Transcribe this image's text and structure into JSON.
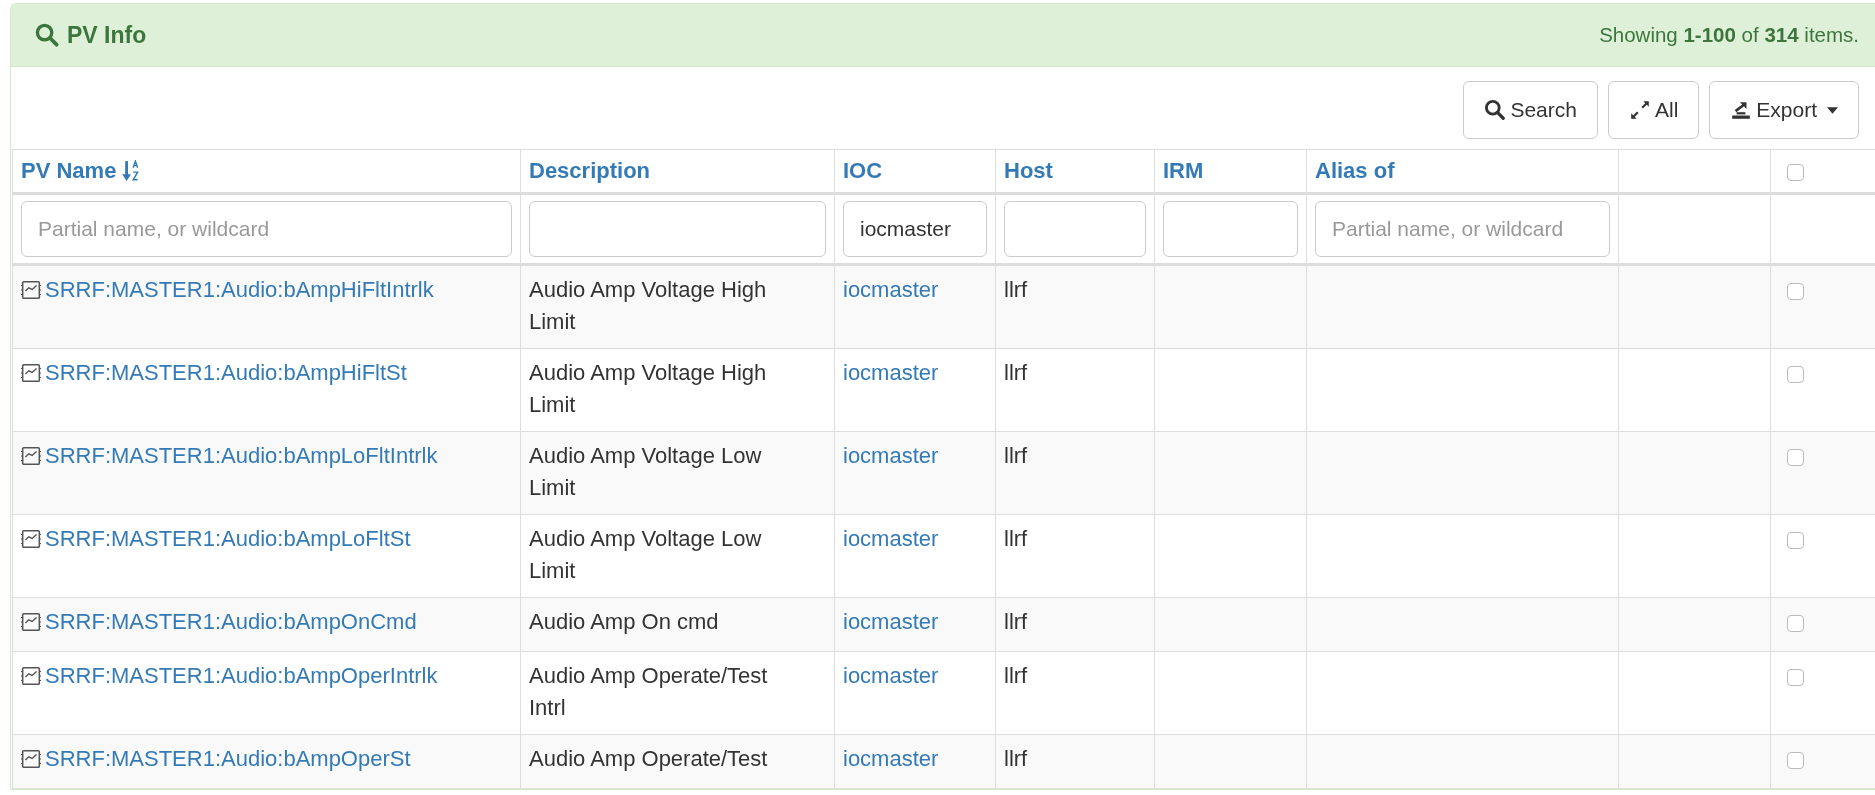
{
  "panel": {
    "title": "PV Info",
    "summary": "Showing **1-100** of **314** items."
  },
  "toolbar": {
    "buttons": [
      {
        "label": "Search",
        "kind": "search"
      },
      {
        "label": "All",
        "kind": "expand"
      },
      {
        "label": "Export",
        "kind": "export"
      }
    ]
  },
  "table": {
    "columns": [
      {
        "label": "PV Name",
        "sorted": true
      },
      {
        "label": "Description",
        "sorted": false
      },
      {
        "label": "IOC",
        "sorted": false
      },
      {
        "label": "Host",
        "sorted": false
      },
      {
        "label": "IRM",
        "sorted": false
      },
      {
        "label": "Alias of",
        "sorted": false
      }
    ],
    "select_all": {
      "checked": false
    },
    "filters": [
      {
        "kind": "input",
        "placeholder": "Partial name, or wildcard"
      },
      {
        "kind": "input"
      },
      {
        "kind": "input",
        "value": "iocmaster"
      },
      {
        "kind": "input"
      },
      {
        "kind": "input"
      },
      {
        "kind": "input",
        "placeholder": "Partial name, or wildcard"
      },
      {
        "kind": "none"
      }
    ],
    "rows": [
      {
        "pv_name": "SRRF:MASTER1:Audio:bAmpHiFltIntrlk",
        "description": "Audio Amp Voltage High Limit",
        "ioc": "iocmaster",
        "host": "llrf",
        "checked": false
      },
      {
        "pv_name": "SRRF:MASTER1:Audio:bAmpHiFltSt",
        "description": "Audio Amp Voltage High Limit",
        "ioc": "iocmaster",
        "host": "llrf",
        "checked": false
      },
      {
        "pv_name": "SRRF:MASTER1:Audio:bAmpLoFltIntrlk",
        "description": "Audio Amp Voltage Low Limit",
        "ioc": "iocmaster",
        "host": "llrf",
        "checked": false
      },
      {
        "pv_name": "SRRF:MASTER1:Audio:bAmpLoFltSt",
        "description": "Audio Amp Voltage Low Limit",
        "ioc": "iocmaster",
        "host": "llrf",
        "checked": false
      },
      {
        "pv_name": "SRRF:MASTER1:Audio:bAmpOnCmd",
        "description": "Audio Amp On cmd",
        "ioc": "iocmaster",
        "host": "llrf",
        "checked": false
      },
      {
        "pv_name": "SRRF:MASTER1:Audio:bAmpOperIntrlk",
        "description": "Audio Amp Operate/Test Intrl",
        "ioc": "iocmaster",
        "host": "llrf",
        "checked": false
      },
      {
        "pv_name": "SRRF:MASTER1:Audio:bAmpOperSt",
        "description": "Audio Amp Operate/Test",
        "ioc": "iocmaster",
        "host": "llrf",
        "checked": false
      }
    ]
  }
}
